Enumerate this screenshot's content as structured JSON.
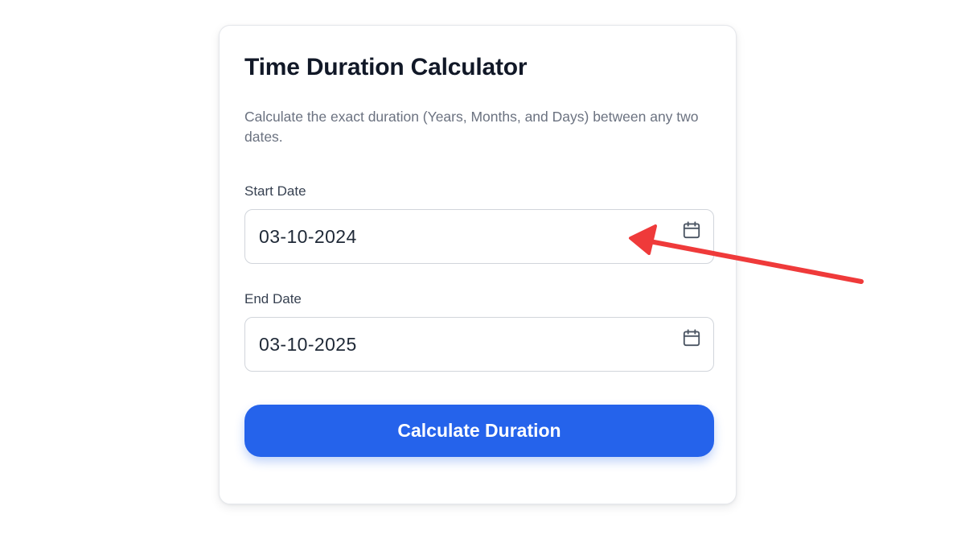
{
  "calculator": {
    "title": "Time Duration Calculator",
    "description": "Calculate the exact duration (Years, Months, and Days) between any two dates.",
    "start_date": {
      "label": "Start Date",
      "value": "03-10-2024",
      "icon": "calendar-icon"
    },
    "end_date": {
      "label": "End Date",
      "value": "03-10-2025",
      "icon": "calendar-icon"
    },
    "calculate_label": "Calculate Duration"
  },
  "annotation": {
    "icon": "red-arrow-icon",
    "color": "#ef3a3a"
  },
  "colors": {
    "accent": "#2563eb",
    "title": "#111827",
    "muted": "#6b7280",
    "border": "#d1d5db"
  }
}
